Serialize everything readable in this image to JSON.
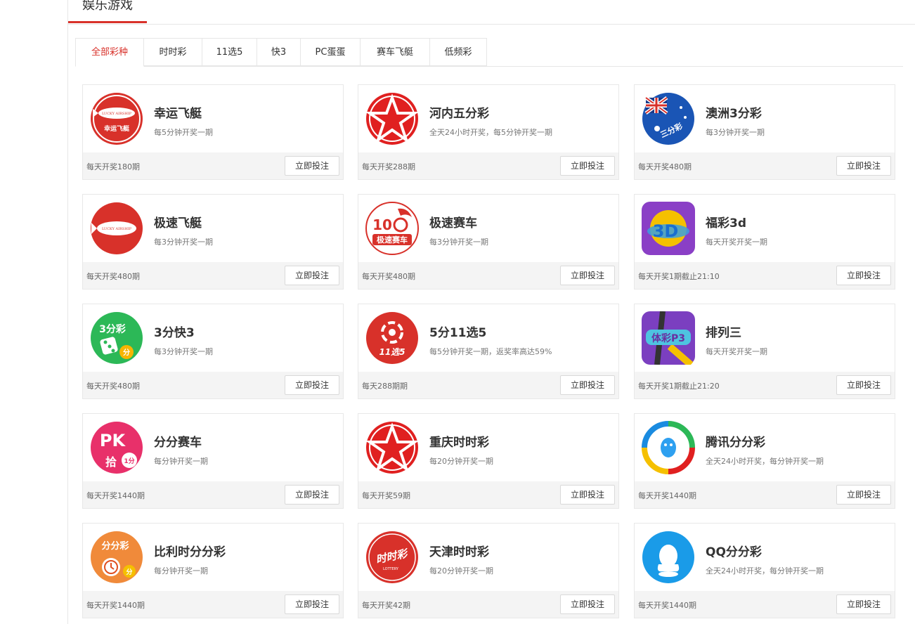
{
  "header": {
    "title": "娱乐游戏"
  },
  "tabs": [
    "全部彩种",
    "时时彩",
    "11选5",
    "快3",
    "PC蛋蛋",
    "赛车飞艇",
    "低频彩"
  ],
  "active_tab": "全部彩种",
  "button_label": "立即投注",
  "colors": {
    "accent": "#d8312a",
    "footer_bg": "#f4f4f4"
  },
  "games": [
    {
      "name": "幸运飞艇",
      "desc": "每5分钟开奖一期",
      "count": "每天开奖180期",
      "icon": "airship-icon",
      "logo_text": "幸运飞艇",
      "logo_small": "LUCKY AIRSHIP"
    },
    {
      "name": "河内五分彩",
      "desc": "全天24小时开奖，每5分钟开奖一期",
      "count": "每天开奖288期",
      "icon": "star-lottery-icon"
    },
    {
      "name": "澳洲3分彩",
      "desc": "每3分钟开奖一期",
      "count": "每天开奖480期",
      "icon": "australia-flag-icon",
      "logo_text": "三分彩"
    },
    {
      "name": "极速飞艇",
      "desc": "每3分钟开奖一期",
      "count": "每天开奖480期",
      "icon": "airship-icon",
      "logo_small": "LUCKY AIRSHIP"
    },
    {
      "name": "极速赛车",
      "desc": "每3分钟开奖一期",
      "count": "每天开奖480期",
      "icon": "racing-icon",
      "logo_text": "极速赛车",
      "logo_num": "10"
    },
    {
      "name": "福彩3d",
      "desc": "每天开奖开奖一期",
      "count": "每天开奖1期截止21:10",
      "icon": "fucai-3d-icon",
      "logo_text": "3D"
    },
    {
      "name": "3分快3",
      "desc": "每3分钟开奖一期",
      "count": "每天开奖480期",
      "icon": "dice-icon",
      "logo_text": "3分彩",
      "logo_badge": "分"
    },
    {
      "name": "5分11选5",
      "desc": "每5分钟开奖一期，返奖率高达59%",
      "count": "每天288期期",
      "icon": "pick5-icon",
      "logo_text": "11选5"
    },
    {
      "name": "排列三",
      "desc": "每天开奖开奖一期",
      "count": "每天开奖1期截止21:20",
      "icon": "tiyu-p3-icon",
      "logo_text": "体彩P3"
    },
    {
      "name": "分分赛车",
      "desc": "每分钟开奖一期",
      "count": "每天开奖1440期",
      "icon": "pk10-icon",
      "logo_text": "PK",
      "logo_sub": "拾",
      "logo_badge": "1分"
    },
    {
      "name": "重庆时时彩",
      "desc": "每20分钟开奖一期",
      "count": "每天开奖59期",
      "icon": "star-lottery-icon"
    },
    {
      "name": "腾讯分分彩",
      "desc": "全天24小时开奖，每分钟开奖一期",
      "count": "每天开奖1440期",
      "icon": "tencent-icon"
    },
    {
      "name": "比利时分分彩",
      "desc": "每分钟开奖一期",
      "count": "每天开奖1440期",
      "icon": "alarm-clock-icon",
      "logo_text": "分分彩",
      "logo_badge": "分"
    },
    {
      "name": "天津时时彩",
      "desc": "每20分钟开奖一期",
      "count": "每天开奖42期",
      "icon": "shishicai-icon",
      "logo_text": "时时彩",
      "logo_small": "LOTTERY"
    },
    {
      "name": "QQ分分彩",
      "desc": "全天24小时开奖，每分钟开奖一期",
      "count": "每天开奖1440期",
      "icon": "qq-penguin-icon"
    }
  ]
}
